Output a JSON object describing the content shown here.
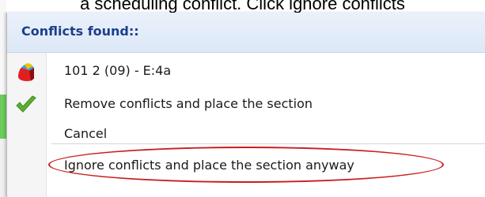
{
  "caption": "a scheduling conflict. Click ignore conflicts",
  "menu": {
    "header": "Conflicts found::",
    "items": [
      {
        "label": "101 2 (09) - E:4a",
        "icon": "section-color-icon"
      },
      {
        "label": "Remove conflicts and place the section",
        "icon": "checkmark-icon"
      },
      {
        "label": "Cancel",
        "icon": ""
      },
      {
        "label": "Ignore conflicts and place the section anyway",
        "icon": ""
      }
    ]
  },
  "colors": {
    "header_text": "#1c3f8c",
    "highlight": "#c81d1d",
    "check": "#5cb030"
  }
}
